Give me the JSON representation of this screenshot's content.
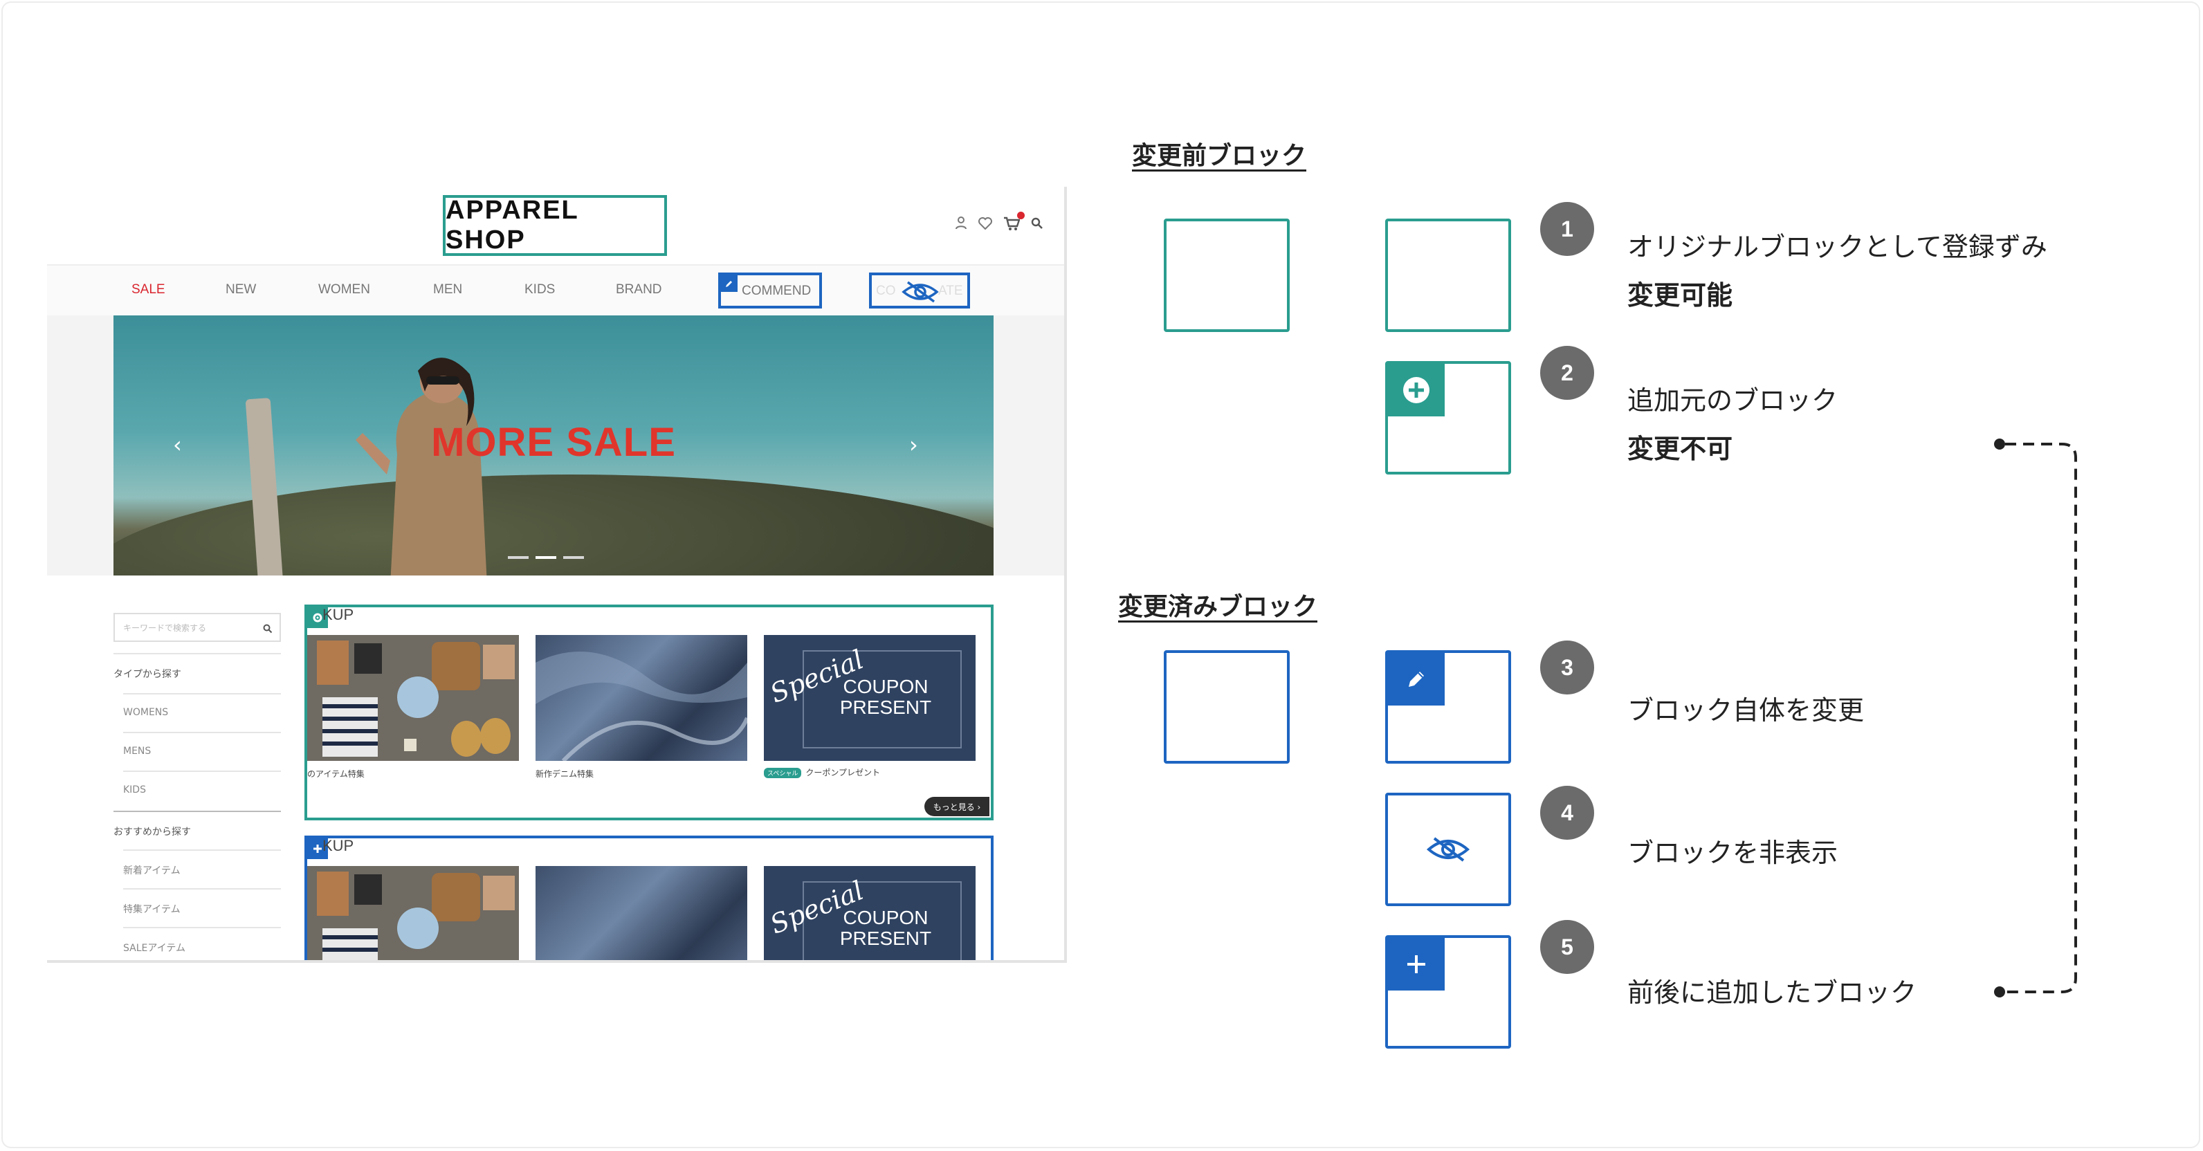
{
  "colors": {
    "green": "#2a9d8f",
    "blue": "#1d65c1",
    "sale_red": "#d9262f",
    "badge_gray": "#6b6b6b"
  },
  "shop": {
    "logo": "APPAREL SHOP",
    "nav": [
      "SALE",
      "NEW",
      "WOMEN",
      "MEN",
      "KIDS",
      "BRAND"
    ],
    "nav_recommend": "COMMEND",
    "nav_hidden_fragment_a": "CO",
    "nav_hidden_fragment_b": "ATE",
    "hero_text": "MORE SALE",
    "hero_prev": "‹",
    "hero_next": "›",
    "sidebar": {
      "search_placeholder": "キーワードで検索する",
      "type_heading": "タイプから探す",
      "type_items": [
        "WOMENS",
        "MENS",
        "KIDS"
      ],
      "rec_heading": "おすすめから探す",
      "rec_items": [
        "新着アイテム",
        "特集アイテム",
        "SALEアイテム"
      ]
    },
    "pickup_title": "KUP",
    "captions": [
      "のアイテム特集",
      "新作デニム特集",
      "クーポンプレゼント"
    ],
    "caption_tag": "スペシャル",
    "more_button": "もっと見る ›",
    "coupon_special": "Special",
    "coupon_line1": "COUPON",
    "coupon_line2": "PRESENT"
  },
  "legend": {
    "before_heading": "変更前ブロック",
    "after_heading": "変更済みブロック",
    "items": [
      {
        "num": "1",
        "line1": "オリジナルブロックとして登録ずみ",
        "line2": "変更可能"
      },
      {
        "num": "2",
        "line1": "追加元のブロック",
        "line2": "変更不可"
      },
      {
        "num": "3",
        "line1": "ブロック自体を変更"
      },
      {
        "num": "4",
        "line1": "ブロックを非表示"
      },
      {
        "num": "5",
        "line1": "前後に追加したブロック"
      }
    ]
  }
}
